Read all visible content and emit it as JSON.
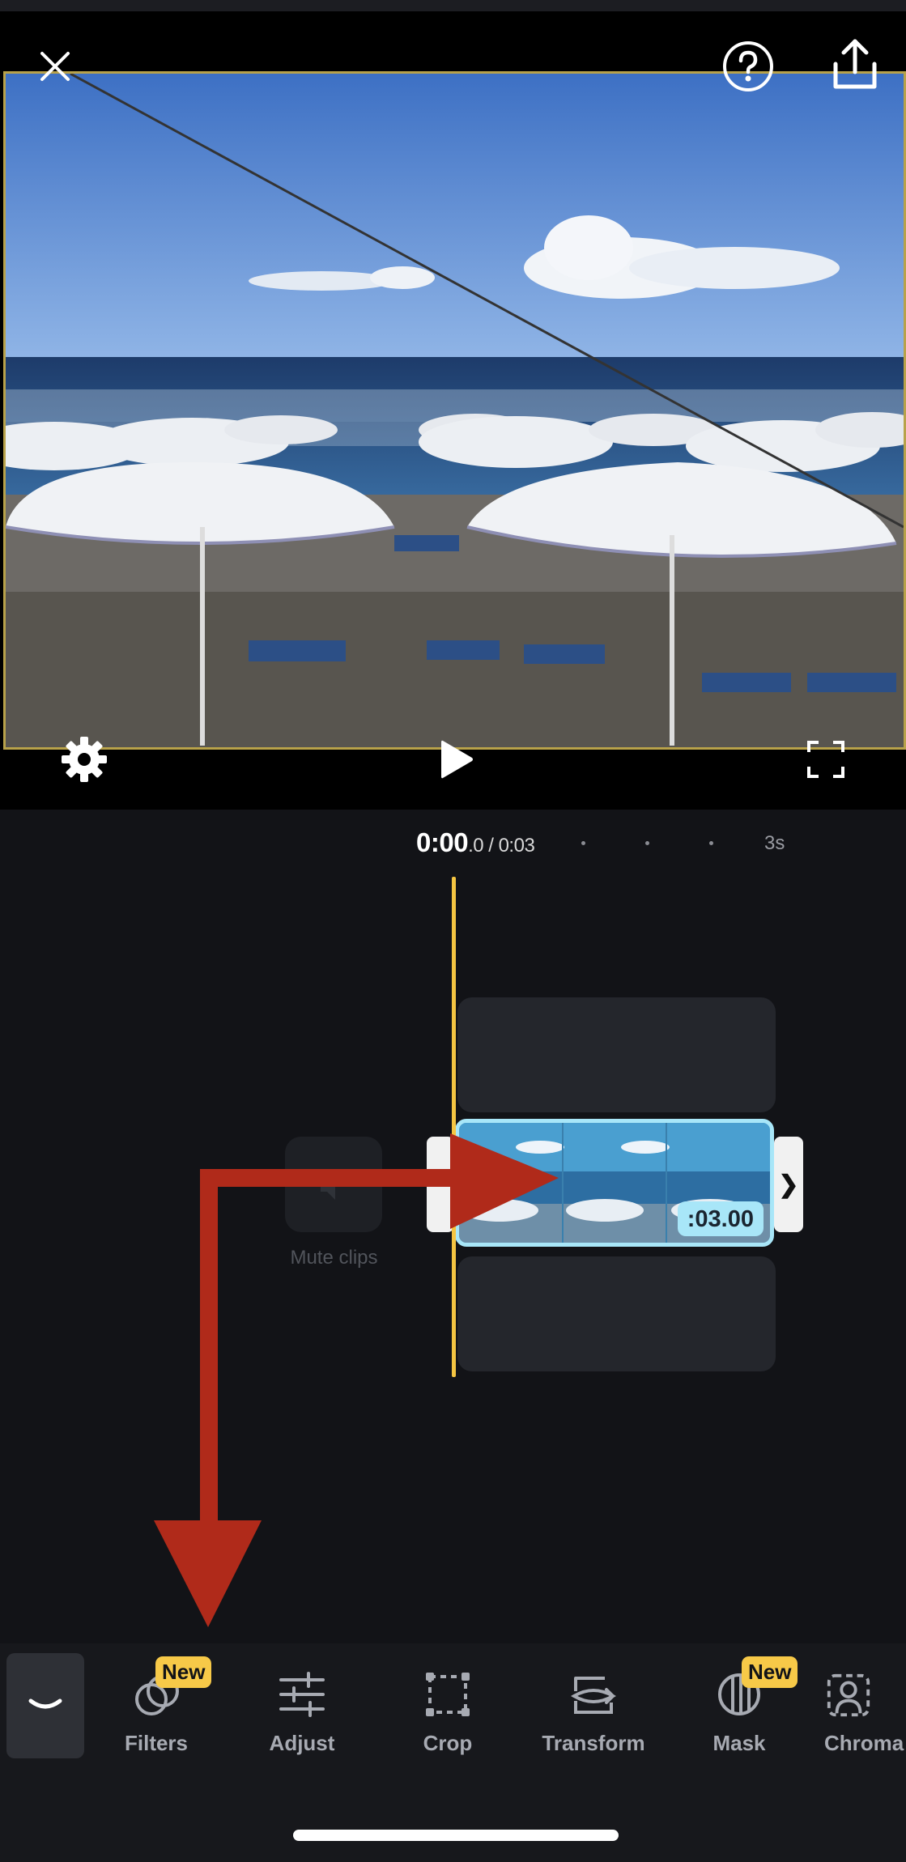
{
  "app": {
    "accent_color": "#f5c542",
    "clip_color": "#a8e6f8",
    "annotation_color": "#b02a1a"
  },
  "header": {
    "close_icon": "close-icon",
    "help_icon": "help-icon",
    "share_icon": "share-icon"
  },
  "preview": {
    "settings_icon": "gear-icon",
    "play_icon": "play-icon",
    "fullscreen_icon": "fullscreen-icon"
  },
  "timeline": {
    "current_time": "0:00",
    "current_time_fraction": ".0",
    "total_time": " / 0:03",
    "end_marker": "3s",
    "clip_duration": ":03.00",
    "mute_label": "Mute clips",
    "trim_right_glyph": "❯"
  },
  "toolbar": {
    "tools": [
      {
        "label": "Filters",
        "badge": "New",
        "icon": "filters-icon"
      },
      {
        "label": "Adjust",
        "icon": "adjust-icon"
      },
      {
        "label": "Crop",
        "icon": "crop-icon"
      },
      {
        "label": "Transform",
        "icon": "transform-icon"
      },
      {
        "label": "Mask",
        "badge": "New",
        "icon": "mask-icon"
      },
      {
        "label": "Chroma",
        "icon": "chroma-icon"
      }
    ],
    "collapse_icon": "chevron-down-icon"
  }
}
